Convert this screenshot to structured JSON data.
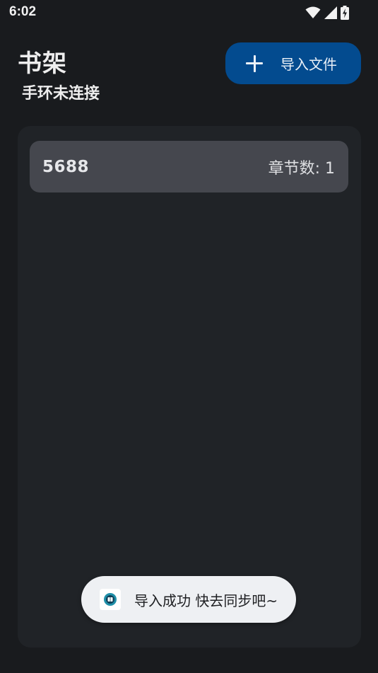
{
  "status_bar": {
    "time": "6:02",
    "icons": [
      "wifi-icon",
      "signal-icon",
      "battery-charging-icon"
    ]
  },
  "header": {
    "title": "书架",
    "subtitle": "手环未连接",
    "import_button": {
      "label": "导入文件",
      "icon": "plus-icon"
    }
  },
  "shelf": {
    "books": [
      {
        "name": "5688",
        "chapter_label": "章节数:",
        "chapter_count": "1"
      }
    ]
  },
  "toast": {
    "icon": "app-logo-icon",
    "message": "导入成功 快去同步吧~"
  },
  "colors": {
    "background": "#191b1e",
    "panel": "#202327",
    "card": "#45474e",
    "accent_button": "#034b8f",
    "toast_background": "#eef0f3"
  }
}
